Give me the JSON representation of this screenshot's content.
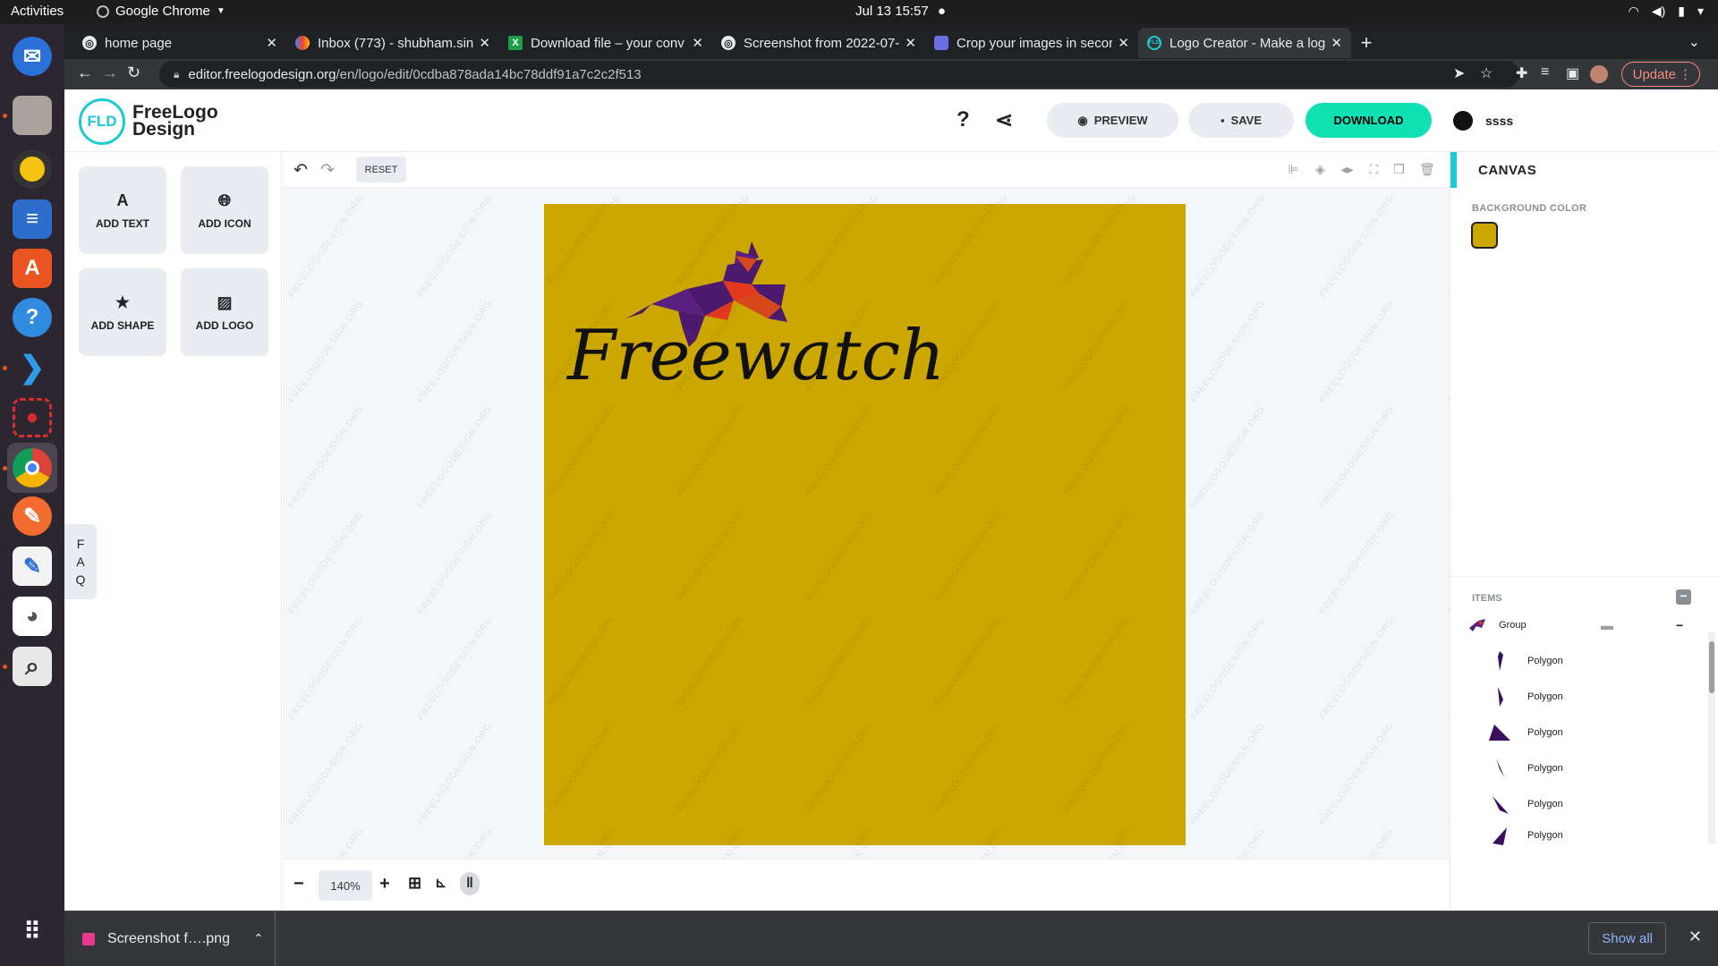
{
  "system": {
    "activities": "Activities",
    "app_name": "Google Chrome",
    "clock": "Jul 13  15:57"
  },
  "dock": {
    "items": [
      "files",
      "rhythmbox",
      "libreoffice-writer",
      "app-center",
      "help",
      "vscode",
      "screen-recorder",
      "chrome",
      "inkscape",
      "text-editor",
      "gimp",
      "image-viewer"
    ]
  },
  "browser": {
    "tabs": [
      {
        "title": "home page",
        "active": false
      },
      {
        "title": "Inbox (773) - shubham.sin",
        "active": false
      },
      {
        "title": "Download file – your conv",
        "active": false
      },
      {
        "title": "Screenshot from 2022-07-",
        "active": false
      },
      {
        "title": "Crop your images in secor",
        "active": false
      },
      {
        "title": "Logo Creator - Make a log",
        "active": true
      }
    ],
    "url_host": "editor.freelogodesign.org",
    "url_path": "/en/logo/edit/0cdba878ada14bc78ddf91a7c2c2f513",
    "update_label": "Update"
  },
  "header": {
    "logo_mark": "FLD",
    "logo_line1": "FreeLogo",
    "logo_line2": "Design",
    "preview_label": "PREVIEW",
    "save_label": "SAVE",
    "download_label": "DOWNLOAD",
    "username": "ssss"
  },
  "tools": {
    "add_text": "ADD TEXT",
    "add_icon": "ADD ICON",
    "add_shape": "ADD SHAPE",
    "add_logo": "ADD LOGO",
    "faq": [
      "F",
      "A",
      "Q"
    ]
  },
  "editor": {
    "reset_label": "RESET",
    "zoom": "140%",
    "watermark": "FREELOGODESIGN.ORG",
    "canvas_bg": "#cca700",
    "logo_text": "Freewatch"
  },
  "right_panel": {
    "title": "CANVAS",
    "bg_color_label": "BACKGROUND COLOR",
    "bg_color": "#cca700",
    "items_label": "ITEMS",
    "items": [
      {
        "label": "Group"
      },
      {
        "label": "Polygon"
      },
      {
        "label": "Polygon"
      },
      {
        "label": "Polygon"
      },
      {
        "label": "Polygon"
      },
      {
        "label": "Polygon"
      },
      {
        "label": "Polygon"
      }
    ]
  },
  "downloads": {
    "file": "Screenshot f….png",
    "show_all": "Show all"
  }
}
